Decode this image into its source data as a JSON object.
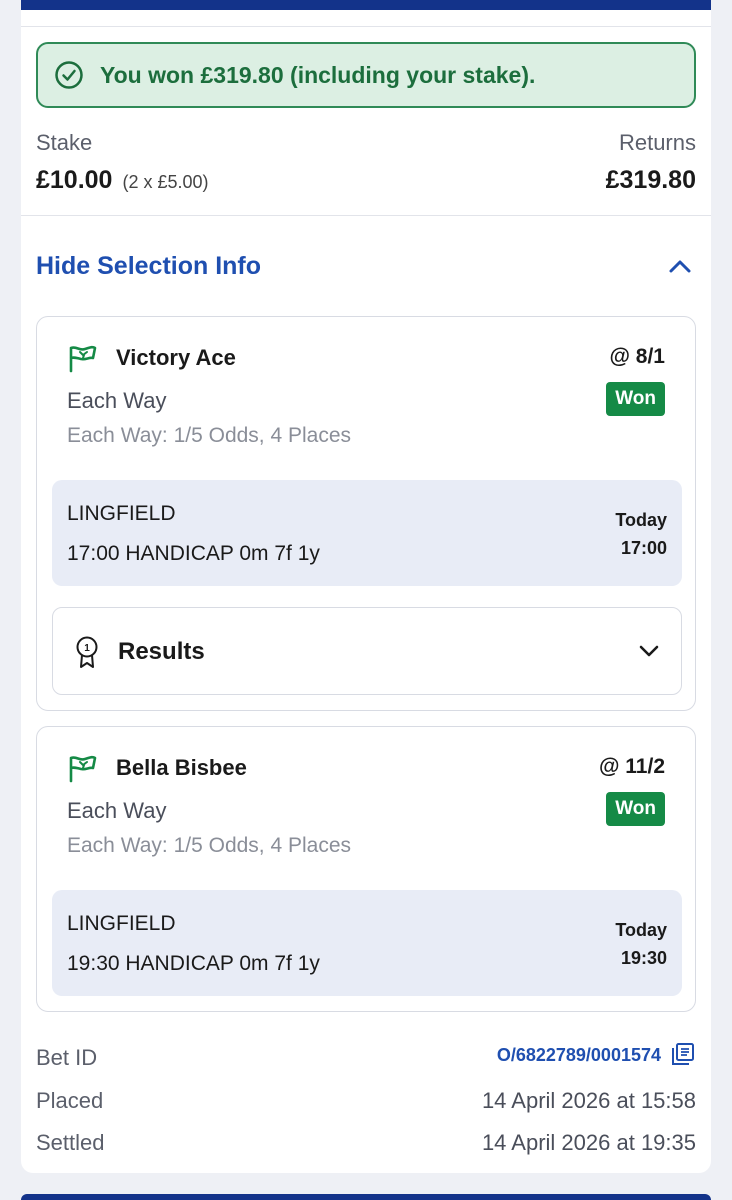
{
  "banner": {
    "message": "You won £319.80 (including your stake)."
  },
  "summary": {
    "stake_label": "Stake",
    "stake_value": "£10.00",
    "stake_detail": "(2 x £5.00)",
    "returns_label": "Returns",
    "returns_value": "£319.80"
  },
  "toggle": {
    "label": "Hide Selection Info"
  },
  "selections": [
    {
      "name": "Victory Ace",
      "odds": "@ 8/1",
      "status": "Won",
      "market": "Each Way",
      "terms": "Each Way: 1/5 Odds, 4 Places",
      "venue": "LINGFIELD",
      "race": "17:00 HANDICAP 0m 7f 1y",
      "day": "Today",
      "time": "17:00",
      "results_label": "Results"
    },
    {
      "name": "Bella Bisbee",
      "odds": "@ 11/2",
      "status": "Won",
      "market": "Each Way",
      "terms": "Each Way: 1/5 Odds, 4 Places",
      "venue": "LINGFIELD",
      "race": "19:30 HANDICAP 0m 7f 1y",
      "day": "Today",
      "time": "19:30"
    }
  ],
  "meta": {
    "bet_id_label": "Bet ID",
    "bet_id_value": "O/6822789/0001574",
    "placed_label": "Placed",
    "placed_value": "14 April 2026 at 15:58",
    "settled_label": "Settled",
    "settled_value": "14 April 2026 at 19:35"
  },
  "colors": {
    "brand_navy": "#13338a",
    "link_blue": "#1f4fb0",
    "won_green": "#158a46",
    "banner_bg": "#dcefe3"
  }
}
